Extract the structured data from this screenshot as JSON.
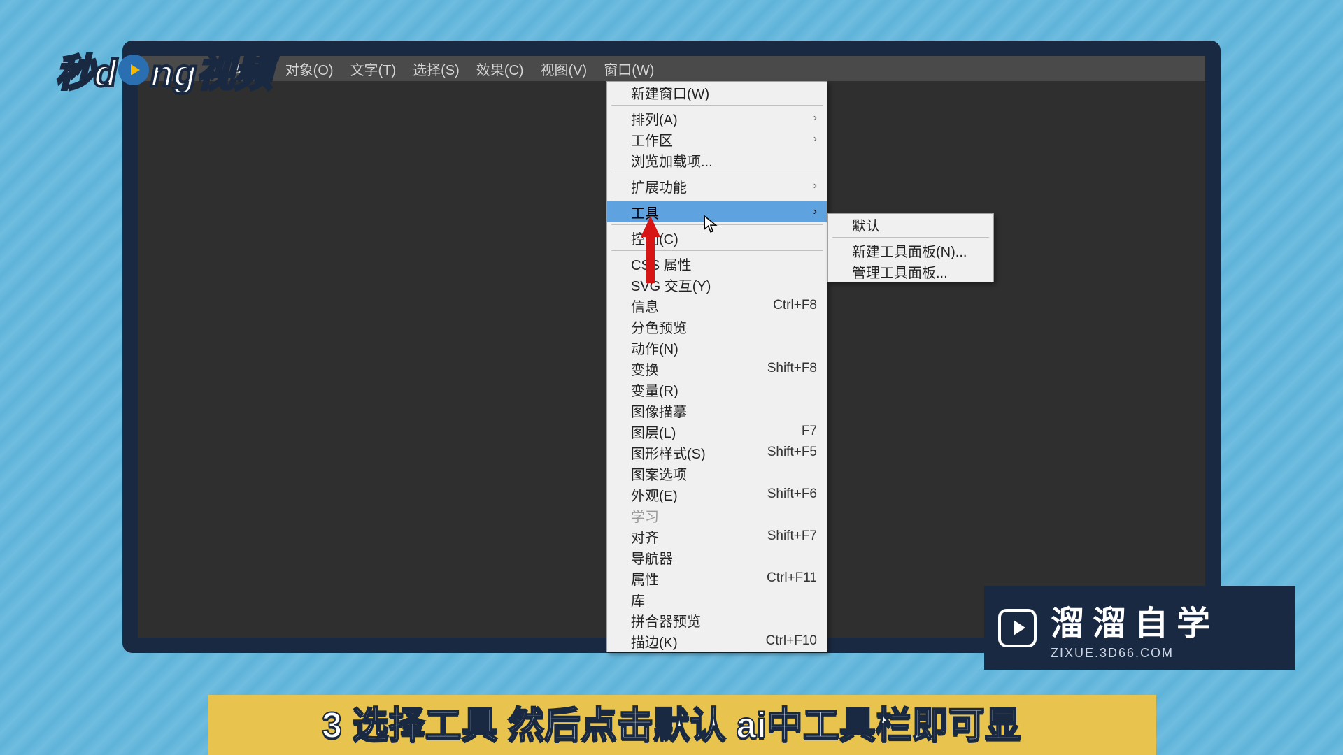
{
  "menubar": {
    "items": [
      "辑(E)",
      "对象(O)",
      "文字(T)",
      "选择(S)",
      "效果(C)",
      "视图(V)",
      "窗口(W)"
    ]
  },
  "window_menu": {
    "top": {
      "label": "新建窗口(W)"
    },
    "group1": [
      {
        "label": "排列(A)",
        "arrow": true
      },
      {
        "label": "工作区",
        "arrow": true
      },
      {
        "label": "浏览加载项..."
      }
    ],
    "ext": {
      "label": "扩展功能",
      "arrow": true
    },
    "tools": {
      "label": "工具",
      "arrow": true,
      "highlighted": true
    },
    "group3": [
      {
        "label": "控制(C)"
      }
    ],
    "group4": [
      {
        "label": "CSS 属性"
      },
      {
        "label": "SVG 交互(Y)"
      },
      {
        "label": "信息",
        "sc": "Ctrl+F8"
      },
      {
        "label": "分色预览"
      },
      {
        "label": "动作(N)"
      },
      {
        "label": "变换",
        "sc": "Shift+F8"
      },
      {
        "label": "变量(R)"
      },
      {
        "label": "图像描摹"
      },
      {
        "label": "图层(L)",
        "sc": "F7"
      },
      {
        "label": "图形样式(S)",
        "sc": "Shift+F5"
      },
      {
        "label": "图案选项"
      },
      {
        "label": "外观(E)",
        "sc": "Shift+F6"
      },
      {
        "label": "学习",
        "disabled": true
      },
      {
        "label": "对齐",
        "sc": "Shift+F7"
      },
      {
        "label": "导航器"
      },
      {
        "label": "属性",
        "sc": "Ctrl+F11"
      },
      {
        "label": "库"
      },
      {
        "label": "拼合器预览"
      },
      {
        "label": "描边(K)",
        "sc": "Ctrl+F10"
      }
    ]
  },
  "submenu": {
    "items": [
      {
        "label": "默认"
      },
      {
        "label": "新建工具面板(N)..."
      },
      {
        "label": "管理工具面板..."
      }
    ]
  },
  "watermark_tl": {
    "p1": "秒d",
    "p2": "ng视频"
  },
  "brand_br": {
    "title": "溜溜自学",
    "domain": "ZIXUE.3D66.COM"
  },
  "subtitle": "3 选择工具 然后点击默认 ai中工具栏即可显"
}
